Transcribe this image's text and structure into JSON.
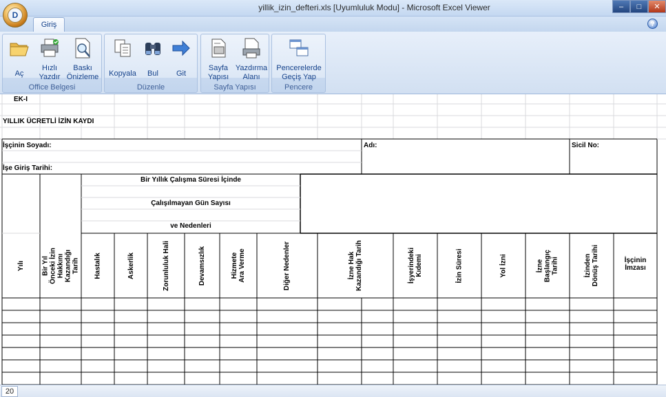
{
  "window": {
    "title": "yillik_izin_defteri.xls  [Uyumluluk Modu] - Microsoft Excel Viewer",
    "office_button": "D",
    "buttons": {
      "minimize": "–",
      "maximize": "□",
      "close": "✕"
    }
  },
  "ribbon": {
    "active_tab": "Giriş",
    "help": "?",
    "groups": [
      {
        "label": "Office Belgesi",
        "buttons": [
          {
            "label": "Aç",
            "icon": "open-folder-icon"
          },
          {
            "label": "Hızlı Yazdır",
            "icon": "quick-print-icon"
          },
          {
            "label": "Baskı Önizleme",
            "icon": "print-preview-icon"
          }
        ]
      },
      {
        "label": "Düzenle",
        "buttons": [
          {
            "label": "Kopyala",
            "icon": "copy-icon"
          },
          {
            "label": "Bul",
            "icon": "binoculars-icon"
          },
          {
            "label": "Git",
            "icon": "arrow-right-icon"
          }
        ]
      },
      {
        "label": "Sayfa Yapısı",
        "buttons": [
          {
            "label": "Sayfa Yapısı",
            "icon": "page-setup-icon"
          },
          {
            "label": "Yazdırma Alanı",
            "icon": "print-area-icon"
          }
        ]
      },
      {
        "label": "Pencere",
        "buttons": [
          {
            "label": "Pencerelerde Geçiş Yap",
            "icon": "switch-windows-icon"
          }
        ]
      }
    ]
  },
  "sheet": {
    "ek": "EK-I",
    "title": "YILLIK ÜCRETLİ İZİN KAYDI",
    "soyadi": "İşçinin Soyadı:",
    "adi": "Adı:",
    "sicil": "Sicil No:",
    "giris": "İşe Giriş Tarihi:",
    "calisma_1": "Bir Yıllık Çalışma Süresi İçinde",
    "calisma_2": "Çalışılmayan Gün Sayısı",
    "calisma_3": "ve Nedenleri",
    "headers": {
      "yili": "Yılı",
      "onceki": "Bir Yıl Önceki İzin Hakkını Kazandığı Tarih",
      "hastalik": "Hastalık",
      "askerlik": "Askerlik",
      "zorunluluk": "Zorunluluk Hali",
      "devamsizlik": "Devamsızlık",
      "hizmete": "Hizmete Ara Verme",
      "diger": "Diğer Nedenler",
      "hak": "İzne Hak Kazandığı Tarih",
      "kidemi": "İşyerindeki Kıdemi",
      "suresi": "İzin Süresi",
      "yol": "Yol İzni",
      "baslangic": "İzne Başlangıç Tarihi",
      "donus": "İzinden Dönüş Tarihi",
      "imzasi_1": "İşçinin",
      "imzasi_2": "İmzası"
    }
  },
  "status": {
    "row": "20"
  }
}
